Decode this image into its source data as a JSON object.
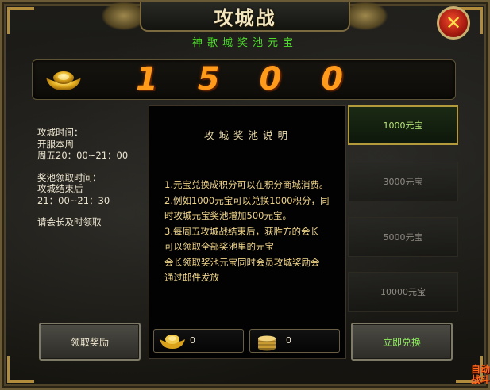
{
  "title": "攻城战",
  "subtitle": "神歌城奖池元宝",
  "prize": {
    "amount": "1 5 0 0"
  },
  "info": {
    "siege_time_label": "攻城时间：",
    "siege_time_line1": "开服本周",
    "siege_time_line2": "周五20：00~21：00",
    "claim_time_label": "奖池领取时间：",
    "claim_time_line1": "攻城结束后",
    "claim_time_line2": "21：00~21：30",
    "note": "请会长及时领取"
  },
  "rules": {
    "title": "攻城奖池说明",
    "lines": [
      "1.元宝兑换成积分可以在积分商城消费。",
      "2.例如1000元宝可以兑换1000积分，同",
      "时攻城元宝奖池增加500元宝。",
      "3.每周五攻城战结束后，获胜方的会长",
      "可以领取全部奖池里的元宝",
      "会长领取奖池元宝同时会员攻城奖励会",
      "通过邮件发放"
    ]
  },
  "counters": {
    "ingot_value": "0",
    "coin_value": "0"
  },
  "options": [
    "1000元宝",
    "3000元宝",
    "5000元宝",
    "10000元宝"
  ],
  "buttons": {
    "claim": "领取奖励",
    "exchange": "立即兑换",
    "close": "✕"
  },
  "corner_logo": "自动\n战斗",
  "colors": {
    "prize": "#ff9a1a",
    "subtitle": "#4fdc2c",
    "rules_text": "#f0d58a",
    "selected_border": "#b39a3a"
  },
  "icons": [
    "gold-ingot-icon",
    "coin-stack-icon",
    "close-icon",
    "dragon-ornament-icon"
  ],
  "state": {
    "selected_option": "1000元宝"
  }
}
